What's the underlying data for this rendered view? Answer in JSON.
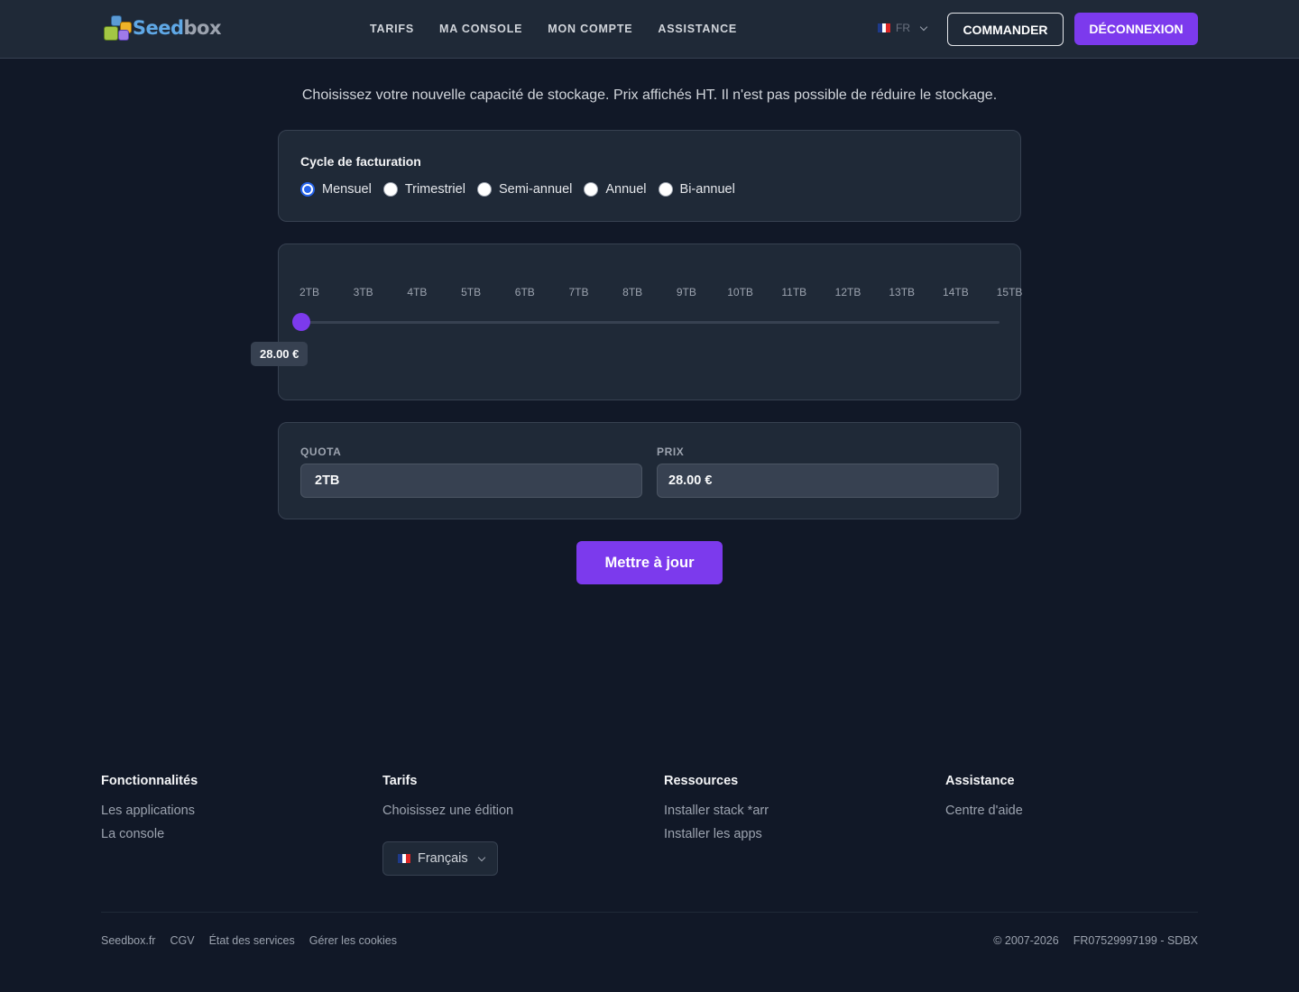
{
  "header": {
    "brand_part1": "Seed",
    "brand_part2": "box",
    "nav": [
      "TARIFS",
      "MA CONSOLE",
      "MON COMPTE",
      "ASSISTANCE"
    ],
    "language": "FR",
    "order_label": "COMMANDER",
    "logout_label": "DÉCONNEXION"
  },
  "main": {
    "intro": "Choisissez votre nouvelle capacité de stockage. Prix affichés HT. Il n'est pas possible de réduire le stockage.",
    "billing": {
      "title": "Cycle de facturation",
      "options": [
        "Mensuel",
        "Trimestriel",
        "Semi-annuel",
        "Annuel",
        "Bi-annuel"
      ],
      "selected": "Mensuel"
    },
    "slider": {
      "ticks": [
        "2TB",
        "3TB",
        "4TB",
        "5TB",
        "6TB",
        "7TB",
        "8TB",
        "9TB",
        "10TB",
        "11TB",
        "12TB",
        "13TB",
        "14TB",
        "15TB"
      ],
      "value": "2TB",
      "tooltip": "28.00 €"
    },
    "quota": {
      "label": "QUOTA",
      "value": "2TB"
    },
    "price": {
      "label": "PRIX",
      "value": "28.00 €"
    },
    "update_label": "Mettre à jour"
  },
  "footer": {
    "columns": [
      {
        "title": "Fonctionnalités",
        "links": [
          "Les applications",
          "La console"
        ]
      },
      {
        "title": "Tarifs",
        "links": [
          "Choisissez une édition"
        ]
      },
      {
        "title": "Ressources",
        "links": [
          "Installer stack *arr",
          "Installer les apps"
        ]
      },
      {
        "title": "Assistance",
        "links": [
          "Centre d'aide"
        ]
      }
    ],
    "language_select": "Français",
    "bottom_links": [
      "Seedbox.fr",
      "CGV",
      "État des services",
      "Gérer les cookies"
    ],
    "copyright": "© 2007-2026",
    "company_id": "FR07529997199 - SDBX"
  },
  "colors": {
    "accent": "#7c3aed",
    "background": "#111827",
    "card": "#1f2937",
    "radio_selected": "#2563eb"
  }
}
